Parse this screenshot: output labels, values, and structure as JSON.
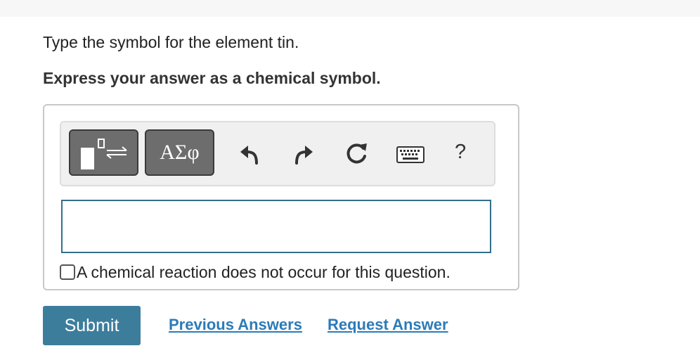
{
  "question": {
    "prompt": "Type the symbol for the element tin.",
    "instruction": "Express your answer as a chemical symbol."
  },
  "toolbar": {
    "templates_icon": "templates-arrows-icon",
    "greek_label": "ΑΣφ",
    "undo_icon": "undo-arrow-icon",
    "redo_icon": "redo-arrow-icon",
    "reset_icon": "reset-circular-arrow-icon",
    "keyboard_icon": "keyboard-icon",
    "help_label": "?"
  },
  "answer": {
    "value": "",
    "placeholder": ""
  },
  "no_reaction": {
    "label": "A chemical reaction does not occur for this question.",
    "checked": false
  },
  "actions": {
    "submit_label": "Submit",
    "previous_answers_label": "Previous Answers",
    "request_answer_label": "Request Answer"
  },
  "colors": {
    "submit_bg": "#3d7d9c",
    "link": "#2c7bb8",
    "input_border": "#336f8a",
    "tool_button_bg": "#6d6d6d"
  }
}
